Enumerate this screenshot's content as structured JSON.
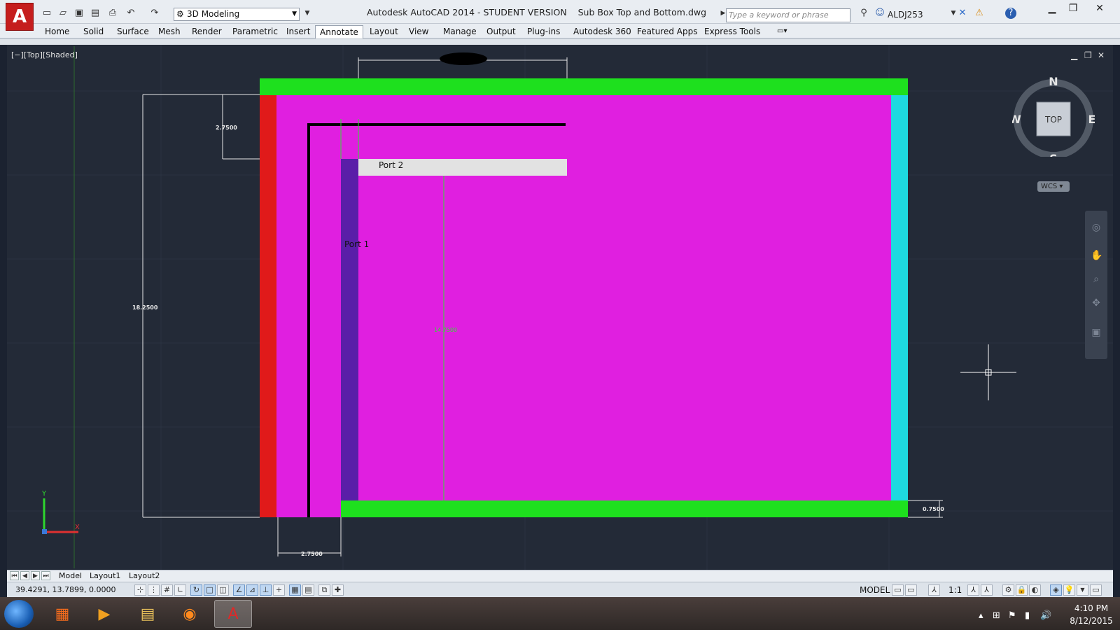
{
  "window": {
    "title_app": "Autodesk AutoCAD 2014 - STUDENT VERSION",
    "title_file": "Sub Box Top and Bottom.dwg",
    "workspace": "3D Modeling",
    "search_placeholder": "Type a keyword or phrase",
    "user": "ALDJ253"
  },
  "ribbon": {
    "tabs": [
      "Home",
      "Solid",
      "Surface",
      "Mesh",
      "Render",
      "Parametric",
      "Insert",
      "Annotate",
      "Layout",
      "View",
      "Manage",
      "Output",
      "Plug-ins",
      "Autodesk 360",
      "Featured Apps",
      "Express Tools"
    ],
    "active_tab": "Annotate"
  },
  "viewport": {
    "label": "[−][Top][Shaded]"
  },
  "drawing": {
    "labels": {
      "port1": "Port 1",
      "port2": "Port 2"
    },
    "dimensions": {
      "top_offset": "2.7500",
      "overall_height": "18.2500",
      "inner_height": "14.7500",
      "bottom_width": "2.7500",
      "wall_thickness": "0.7500"
    },
    "colors": {
      "interior": "#e01fe0",
      "top_bottom_panels": "#1ee01e",
      "left_panel": "#e01a1a",
      "right_panel": "#1ed9e0",
      "port1_wall": "#5a1ea8",
      "port2_wall": "#e2e2e2"
    }
  },
  "viewcube": {
    "north": "N",
    "south": "S",
    "east": "E",
    "west": "W",
    "face": "TOP",
    "wcs": "WCS"
  },
  "layout_tabs": [
    "Model",
    "Layout1",
    "Layout2"
  ],
  "status": {
    "coordinates": "39.4291, 13.7899, 0.0000",
    "space": "MODEL",
    "annotation_scale": "1:1"
  },
  "clock": {
    "time": "4:10 PM",
    "date": "8/12/2015"
  }
}
